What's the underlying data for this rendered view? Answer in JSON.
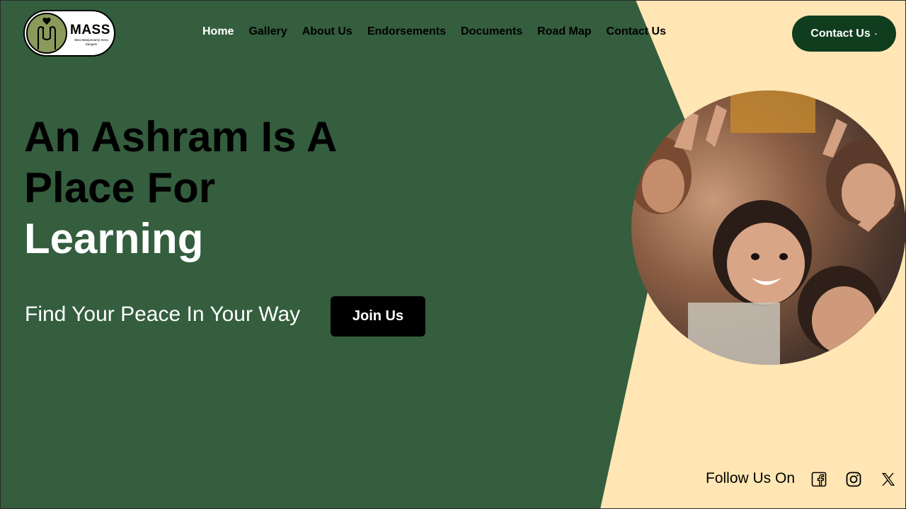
{
  "brand": {
    "name": "MASS",
    "subtitle": "Mira Manjunnamy Seva Sangam",
    "logo_color": "#8a9a5b"
  },
  "nav": {
    "items": [
      {
        "label": "Home",
        "active": true
      },
      {
        "label": "Gallery"
      },
      {
        "label": "About Us"
      },
      {
        "label": "Endorsements"
      },
      {
        "label": "Documents"
      },
      {
        "label": "Road Map"
      },
      {
        "label": "Contact Us"
      }
    ],
    "cta_label": "Contact Us",
    "cta_glyph": "·"
  },
  "hero": {
    "line1": "An Ashram Is A",
    "line2": "Place For",
    "line3": "Learning",
    "tagline": "Find Your Peace In Your Way",
    "join_label": "Join Us"
  },
  "social": {
    "label": "Follow Us On",
    "icons": [
      "facebook-icon",
      "instagram-icon",
      "x-icon"
    ]
  },
  "colors": {
    "primary_green": "#345e3e",
    "cream": "#ffe6b4",
    "dark_green": "#0f3d1e"
  }
}
